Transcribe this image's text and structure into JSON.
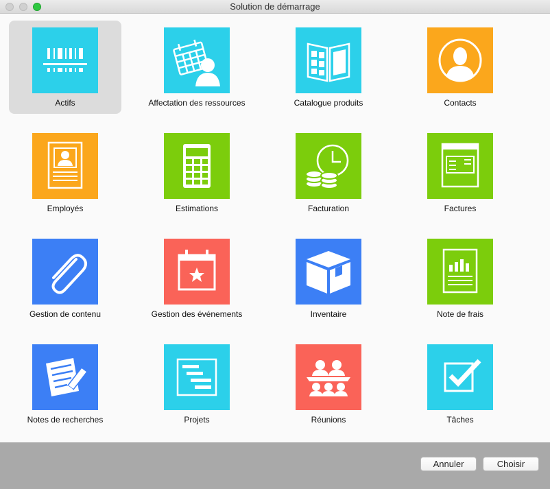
{
  "window": {
    "title": "Solution de démarrage"
  },
  "templates": [
    {
      "label": "Actifs",
      "icon": "barcode-icon",
      "color": "cyan",
      "selected": true
    },
    {
      "label": "Affectation des ressources",
      "icon": "calendar-person-icon",
      "color": "cyan"
    },
    {
      "label": "Catalogue produits",
      "icon": "catalog-icon",
      "color": "cyan"
    },
    {
      "label": "Contacts",
      "icon": "contact-icon",
      "color": "orange"
    },
    {
      "label": "Employés",
      "icon": "badge-icon",
      "color": "orange"
    },
    {
      "label": "Estimations",
      "icon": "calculator-icon",
      "color": "green"
    },
    {
      "label": "Facturation",
      "icon": "clock-coins-icon",
      "color": "green"
    },
    {
      "label": "Factures",
      "icon": "invoice-icon",
      "color": "green"
    },
    {
      "label": "Gestion de contenu",
      "icon": "paperclip-icon",
      "color": "blue"
    },
    {
      "label": "Gestion des événements",
      "icon": "calendar-star-icon",
      "color": "red"
    },
    {
      "label": "Inventaire",
      "icon": "box-icon",
      "color": "blue"
    },
    {
      "label": "Note de frais",
      "icon": "report-chart-icon",
      "color": "green"
    },
    {
      "label": "Notes de recherches",
      "icon": "notepad-pencil-icon",
      "color": "blue"
    },
    {
      "label": "Projets",
      "icon": "gantt-icon",
      "color": "cyan"
    },
    {
      "label": "Réunions",
      "icon": "meeting-icon",
      "color": "red"
    },
    {
      "label": "Tâches",
      "icon": "checkbox-icon",
      "color": "cyan"
    }
  ],
  "colors": {
    "cyan": "#2cd0ea",
    "orange": "#fba71c",
    "green": "#7ccd0c",
    "blue": "#3c7ff5",
    "red": "#fa6358",
    "selection": "#dcdcdc"
  },
  "buttons": {
    "cancel": "Annuler",
    "choose": "Choisir"
  }
}
